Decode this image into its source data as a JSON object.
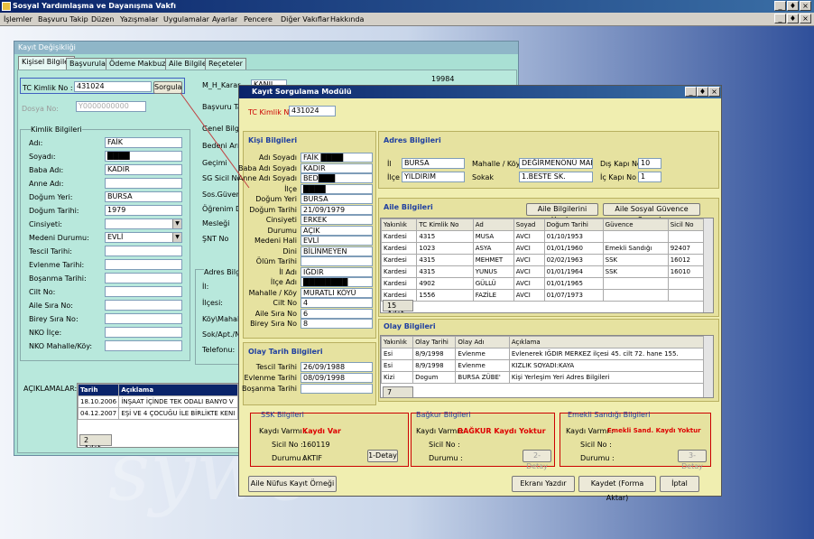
{
  "app": {
    "title": "Sosyal Yardımlaşma ve Dayanışma Vakfı",
    "controls": [
      "_",
      "♦",
      "×"
    ],
    "mdi_controls": [
      "_",
      "♦",
      "×"
    ]
  },
  "menu": [
    "İşlemler",
    "Başvuru Takip",
    "Düzen",
    "Yazışmalar",
    "Uygulamalar",
    "Ayarlar",
    "Pencere",
    "Diğer Vakıflar",
    "Hakkında"
  ],
  "watermark": "sywe",
  "kd": {
    "title": "Kayıt Değişikliği",
    "tabs": [
      "Kişisel Bilgiler",
      "Başvurular",
      "Ödeme Makbuzu",
      "Aile Bilgileri",
      "Reçeteler"
    ],
    "tc_label": "TC Kimlik No :",
    "tc_value": "431024",
    "sorgula": "Sorgula",
    "dosya_label": "Dosya No:",
    "dosya_value": "Y0000000000",
    "num_right": "19984",
    "kimlik_title": "Kimlik Bilgileri",
    "fields": [
      {
        "l": "Adı:",
        "v": "FAİK"
      },
      {
        "l": "Soyadı:",
        "v": "████"
      },
      {
        "l": "Baba Adı:",
        "v": "KADIR"
      },
      {
        "l": "Anne Adı:",
        "v": ""
      },
      {
        "l": "Doğum Yeri:",
        "v": "BURSA"
      },
      {
        "l": "Doğum Tarihi:",
        "v": "1979"
      },
      {
        "l": "Cinsiyeti:",
        "v": ""
      },
      {
        "l": "Medeni Durumu:",
        "v": "EVLİ"
      },
      {
        "l": "Tescil Tarihi:",
        "v": ""
      },
      {
        "l": "Evlenme Tarihi:",
        "v": ""
      },
      {
        "l": "Boşanma Tarihi:",
        "v": ""
      },
      {
        "l": "Cilt No:",
        "v": ""
      },
      {
        "l": "Aile Sıra No:",
        "v": ""
      },
      {
        "l": "Birey Sıra No:",
        "v": ""
      },
      {
        "l": "NKO İlçe:",
        "v": ""
      },
      {
        "l": "NKO Mahalle/Köy:",
        "v": ""
      }
    ],
    "mid_labels": [
      "M_H_Karar",
      "Başvuru Ta",
      "Genel Bilgi",
      "Bedeni Arızı",
      "Geçimi",
      "SG Sicil No",
      "Sos.Güven",
      "Öğrenim Du",
      "Mesleği",
      "ŞNT No"
    ],
    "mid_top": "KANIL",
    "adres_title": "Adres Bilgi",
    "adres_labels": [
      "İl:",
      "İlçesi:",
      "Köy\\Mahal",
      "Sok/Apt./N",
      "Telefonu:"
    ],
    "aciklamalar_label": "AÇIKLAMALAR:",
    "acik_cols": [
      "Tarih",
      "Açıklama"
    ],
    "acik_rows": [
      [
        "18.10.2006",
        "İNŞAAT İÇİNDE TEK ODALI BANYO V"
      ],
      [
        "04.12.2007",
        "EŞİ VE 4 ÇOCUĞU İLE BİRLİKTE KENI"
      ]
    ],
    "acik_count": "2 Adet"
  },
  "ks": {
    "title": "Kayıt Sorgulama Modülü",
    "tc_label": "TC Kimlik No",
    "tc_value": "431024",
    "kisi_title": "Kişi Bilgileri",
    "kisi": [
      {
        "l": "Adı Soyadı",
        "v": "FAİK ████"
      },
      {
        "l": "Baba Adı Soyadı",
        "v": "KADIR"
      },
      {
        "l": "Anne Adı Soyadı",
        "v": "BED███"
      },
      {
        "l": "İlçe",
        "v": "████"
      },
      {
        "l": "Doğum Yeri",
        "v": "BURSA"
      },
      {
        "l": "Doğum Tarihi",
        "v": "21/09/1979"
      },
      {
        "l": "Cinsiyeti",
        "v": "ERKEK"
      },
      {
        "l": "Durumu",
        "v": "AÇIK"
      },
      {
        "l": "Medeni Hali",
        "v": "EVLİ"
      },
      {
        "l": "Dini",
        "v": "BİLİNMEYEN"
      },
      {
        "l": "Ölüm Tarihi",
        "v": ""
      },
      {
        "l": "İl Adı",
        "v": "IĞDIR"
      },
      {
        "l": "İlçe Adı",
        "v": "████████"
      },
      {
        "l": "Mahalle / Köy",
        "v": "MURATLI KÖYÜ"
      },
      {
        "l": "Cilt No",
        "v": "4"
      },
      {
        "l": "Aile Sıra No",
        "v": "6"
      },
      {
        "l": "Birey Sıra No",
        "v": "8"
      }
    ],
    "olay_title": "Olay Tarih Bilgileri",
    "olay": [
      {
        "l": "Tescil Tarihi",
        "v": "26/09/1988"
      },
      {
        "l": "Evlenme Tarihi",
        "v": "08/09/1998"
      },
      {
        "l": "Boşanma Tarihi",
        "v": ""
      }
    ],
    "adres_title": "Adres Bilgileri",
    "adres": {
      "il_l": "İl",
      "il": "BURSA",
      "ilce_l": "İlçe",
      "ilce": "YILDIRIM",
      "mah_l": "Mahalle / Köy",
      "mah": "DEĞİRMENÖNÜ MAH",
      "sok_l": "Sokak",
      "sok": "1.BESTE SK.",
      "dis_l": "Dış Kapı No",
      "dis": "10",
      "ic_l": "İç Kapı No",
      "ic": "1"
    },
    "aile_title": "Aile Bilgileri",
    "aile_btn1": "Aile Bilgilerini Yazdır",
    "aile_btn2": "Aile Sosyal Güvence Sorgula",
    "aile_cols": [
      "Yakınlık",
      "TC Kimlik No",
      "Ad",
      "Soyad",
      "Doğum Tarihi",
      "Güvence",
      "Sicil No"
    ],
    "aile_rows": [
      [
        "Kardesi",
        "4315",
        "MUSA",
        "AVCI",
        "01/10/1953",
        "",
        ""
      ],
      [
        "Kardesi",
        "1023",
        "ASYA",
        "AVCI",
        "01/01/1960",
        "Emekli Sandığı",
        "92407"
      ],
      [
        "Kardesi",
        "4315",
        "MEHMET",
        "AVCI",
        "02/02/1963",
        "SSK",
        "16012"
      ],
      [
        "Kardesi",
        "4315",
        "YUNUS",
        "AVCI",
        "01/01/1964",
        "SSK",
        "16010"
      ],
      [
        "Kardesi",
        "4902",
        "GÜLLÜ",
        "AVCI",
        "01/01/1965",
        "",
        ""
      ],
      [
        "Kardesi",
        "1556",
        "FAZİLE",
        "AVCI",
        "01/07/1973",
        "",
        ""
      ]
    ],
    "aile_count": "15 Adet",
    "olay_bil_title": "Olay Bilgileri",
    "olay_cols": [
      "Yakınlık",
      "Olay Tarihi",
      "Olay Adı",
      "Açıklama"
    ],
    "olay_rows": [
      [
        "Esi",
        "8/9/1998",
        "Evlenme",
        "Evlenerek IĞDIR MERKEZ ilçesi 45. cilt 72. hane 155."
      ],
      [
        "Esi",
        "8/9/1998",
        "Evlenme",
        "KIZLIK SOYADI:KAYA"
      ],
      [
        "Kizi",
        "Dogum",
        "BURSA ZÜBE'",
        "Kişi Yerleşim Yeri Adres Bilgileri"
      ]
    ],
    "olay_count": "7 Adet",
    "ssk": {
      "title": "SSK Bilgileri",
      "kv_l": "Kaydı Varmı :",
      "kv": "Kaydı Var",
      "sn_l": "Sicil No :",
      "sn": "160119",
      "d_l": "Durumu :",
      "d": "AKTIF",
      "btn": "1-Detay"
    },
    "bag": {
      "title": "Bağkur Bilgileri",
      "kv_l": "Kaydı Varmı :",
      "kv": "BAĞKUR Kaydı Yoktur",
      "sn_l": "Sicil No :",
      "d_l": "Durumu :",
      "btn": "2-Detay"
    },
    "emk": {
      "title": "Emekli Sandığı Bilgileri",
      "kv_l": "Kaydı Varmı :",
      "kv": "Emekli Sand. Kaydı Yoktur",
      "sn_l": "Sicil No :",
      "d_l": "Durumu :",
      "btn": "3-Detay"
    },
    "buttons": {
      "nufus": "Aile Nüfus Kayıt Örneği",
      "yazdir": "Ekranı Yazdır",
      "kaydet": "Kaydet (Forma Aktar)",
      "iptal": "İptal"
    }
  },
  "colors": {
    "title_bar": "#0a246a",
    "red_text": "#d00000",
    "section_head": "#2040a0",
    "yellow_bg": "#f0eeb0"
  }
}
